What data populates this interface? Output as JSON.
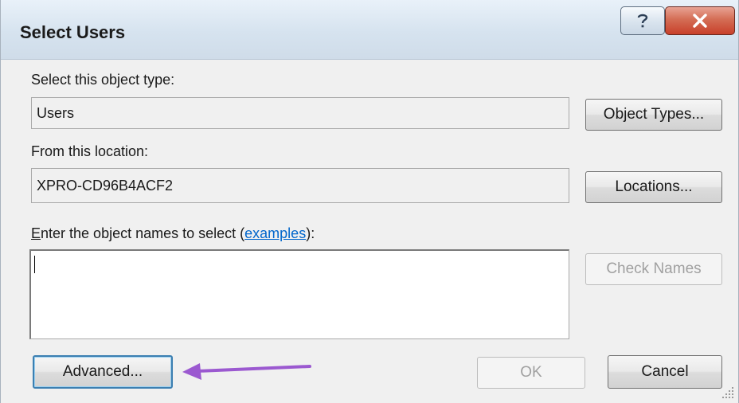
{
  "window": {
    "title": "Select Users",
    "help_button": "?",
    "close_button": "X"
  },
  "object_type": {
    "label": "Select this object type:",
    "value": "Users",
    "button": "Object Types..."
  },
  "location": {
    "label": "From this location:",
    "value": "XPRO-CD96B4ACF2",
    "button": "Locations..."
  },
  "names": {
    "label_access_key": "E",
    "label_rest": "nter the object names to select (",
    "label_link": "examples",
    "label_end": "):",
    "value": "",
    "check_names_button": "Check Names"
  },
  "footer": {
    "advanced_button": "Advanced...",
    "ok_button": "OK",
    "cancel_button": "Cancel"
  },
  "colors": {
    "accent_link": "#0066cc",
    "annotation_arrow": "#9b59d0",
    "close_button": "#c8402a"
  },
  "icons": {
    "help": "help-icon",
    "close": "close-icon",
    "resize": "resize-grip-icon",
    "arrow": "annotation-arrow"
  }
}
